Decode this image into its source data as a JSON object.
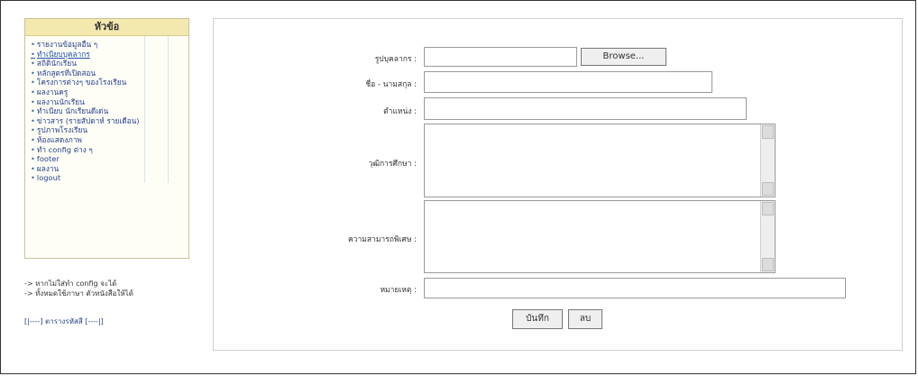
{
  "sidebar": {
    "title": "หัวข้อ",
    "items": [
      {
        "label": "รายงานข้อมูลอื่น ๆ",
        "active": false
      },
      {
        "label": "ทำเนียบบุคลากร",
        "active": true
      },
      {
        "label": "สถิตินักเรียน",
        "active": false
      },
      {
        "label": "หลักสูตรที่เปิดสอน",
        "active": false
      },
      {
        "label": "โครงการต่างๆ ของโรงเรียน",
        "active": false
      },
      {
        "label": "ผลงานครู",
        "active": false
      },
      {
        "label": "ผลงานนักเรียน",
        "active": false
      },
      {
        "label": "ทำเนียบ นักเรียนดีเด่น",
        "active": false
      },
      {
        "label": "ข่าวสาร (รายสัปดาห์ รายเดือน)",
        "active": false
      },
      {
        "label": "รูปภาพโรงเรียน",
        "active": false
      },
      {
        "label": "ห้องแสดงภาพ",
        "active": false
      },
      {
        "label": "ทำ config ต่าง ๆ",
        "active": false
      },
      {
        "label": "footer",
        "active": false
      },
      {
        "label": "ผลงาน",
        "active": false
      },
      {
        "label": "logout",
        "active": false
      }
    ],
    "notes": [
      "-> หากไม่ใส่ทำ config จะได้",
      "-> ทั้งหมดใช้ภาษา ตัวหนังสือให้ได้"
    ],
    "bottom_link": "[|----] ตารางรหัสสี [----|]"
  },
  "form": {
    "photo_label": "รูปบุคลากร :",
    "browse_label": "Browse...",
    "name_label": "ชื่อ - นามสกุล :",
    "position_label": "ตำแหน่ง :",
    "education_label": "วุฒิการศึกษา :",
    "expertise_label": "ความสามารถพิเศษ :",
    "phone_label": "หมายเหตุ :",
    "save_label": "บันทึก",
    "delete_label": "ลบ"
  }
}
